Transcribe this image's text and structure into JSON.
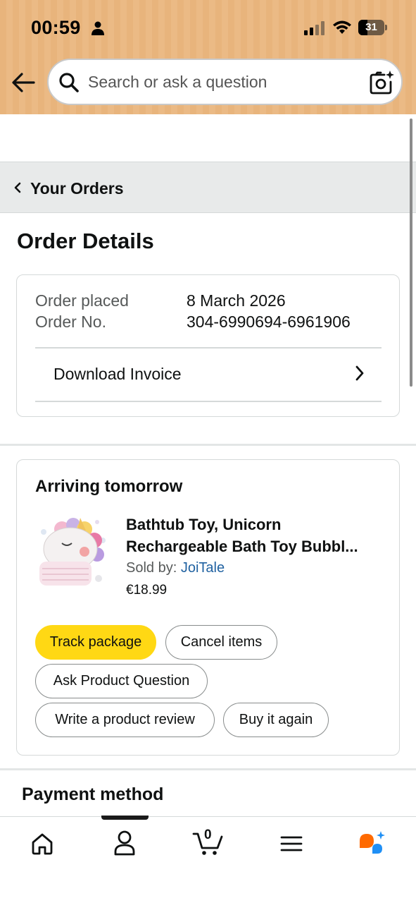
{
  "status_bar": {
    "time": "00:59",
    "battery_level": "31"
  },
  "header": {
    "search_placeholder": "Search or ask a question",
    "icons": [
      "back-arrow-icon",
      "search-icon",
      "camera-search-icon"
    ]
  },
  "breadcrumb": {
    "label": "Your Orders"
  },
  "page": {
    "title": "Order Details"
  },
  "order_info": {
    "placed_label": "Order placed",
    "placed_value": "8 March 2026",
    "number_label": "Order No.",
    "number_value": "304-6990694-6961906",
    "invoice_label": "Download Invoice"
  },
  "shipment": {
    "status": "Arriving tomorrow",
    "product_title_line1": "Bathtub Toy, Unicorn",
    "product_title_line2": "Rechargeable Bath Toy Bubbl...",
    "sold_by_label": "Sold by: ",
    "seller": "JoiTale",
    "price": "€18.99",
    "actions": {
      "track": "Track package",
      "cancel": "Cancel items",
      "ask": "Ask Product Question",
      "review": "Write a product review",
      "buy_again": "Buy it again"
    }
  },
  "payment": {
    "title": "Payment method"
  },
  "bottom_nav": {
    "items": [
      "home-icon",
      "account-icon",
      "cart-icon",
      "menu-icon",
      "assistant-icon"
    ],
    "cart_count": "0",
    "active": "account"
  },
  "colors": {
    "header_bg": "#e8b47c",
    "primary_button": "#ffd814",
    "link": "#2162a1",
    "assistant_orange": "#ff6a00",
    "assistant_blue": "#1f8ff5"
  }
}
